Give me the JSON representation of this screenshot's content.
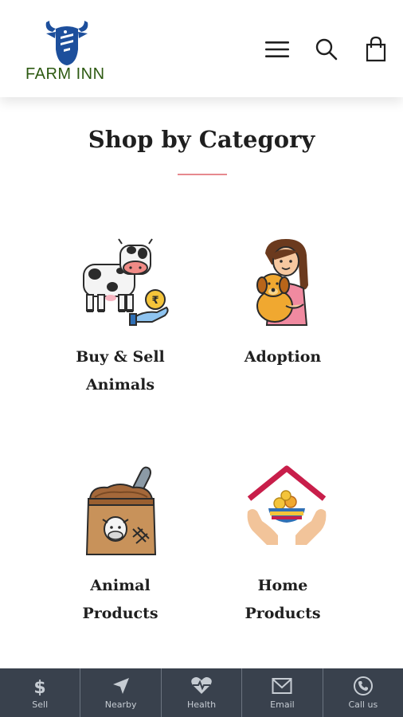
{
  "header": {
    "logo_text": "FARM INN",
    "icons": [
      "menu-icon",
      "search-icon",
      "shopping-bag-icon"
    ]
  },
  "main": {
    "title": "Shop by Category",
    "categories": [
      {
        "line1": "Buy & Sell",
        "line2": "Animals",
        "icon": "cow-rupee-icon"
      },
      {
        "line1": "Adoption",
        "line2": "",
        "icon": "girl-with-dog-icon"
      },
      {
        "line1": "Animal",
        "line2": "Products",
        "icon": "feed-sack-icon"
      },
      {
        "line1": "Home",
        "line2": "Products",
        "icon": "home-bowl-icon"
      }
    ]
  },
  "bottom_nav": {
    "items": [
      {
        "label": "Sell",
        "icon": "dollar-icon"
      },
      {
        "label": "Nearby",
        "icon": "navigation-arrow-icon"
      },
      {
        "label": "Health",
        "icon": "heartbeat-icon"
      },
      {
        "label": "Email",
        "icon": "envelope-icon"
      },
      {
        "label": "Call us",
        "icon": "phone-icon"
      }
    ]
  },
  "colors": {
    "brand_blue": "#1d4f9c",
    "brand_green": "#2d5a12",
    "accent_line": "#e6898e",
    "nav_bg": "#39414d"
  }
}
